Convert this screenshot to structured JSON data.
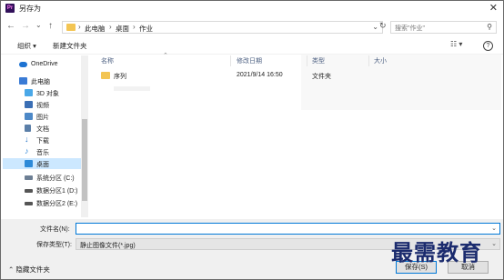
{
  "window": {
    "title": "另存为",
    "app_icon": "Pr",
    "close": "✕"
  },
  "nav": {
    "back": "←",
    "forward": "→",
    "recent": "⌄",
    "up": "↑",
    "breadcrumb": [
      "此电脑",
      "桌面",
      "作业"
    ],
    "refresh": "↻",
    "search_placeholder": "搜索\"作业\""
  },
  "toolbar": {
    "organize": "组织 ▾",
    "new_folder": "新建文件夹",
    "view": "☷ ▾",
    "help": "?"
  },
  "sidebar": {
    "items": [
      {
        "label": "OneDrive",
        "icon": "cloud-icon",
        "color": "#1e73d2"
      },
      {
        "label": "此电脑",
        "icon": "computer-icon",
        "color": "#3a7bd5"
      },
      {
        "label": "3D 对象",
        "icon": "cube-icon",
        "color": "#4aa8e8"
      },
      {
        "label": "视频",
        "icon": "video-icon",
        "color": "#3b6fb5"
      },
      {
        "label": "图片",
        "icon": "picture-icon",
        "color": "#4d88c7"
      },
      {
        "label": "文档",
        "icon": "document-icon",
        "color": "#5b7fa8"
      },
      {
        "label": "下载",
        "icon": "download-icon",
        "color": "#1f6fc4"
      },
      {
        "label": "音乐",
        "icon": "music-icon",
        "color": "#2f86d6"
      },
      {
        "label": "桌面",
        "icon": "desktop-icon",
        "color": "#2d8ad8"
      },
      {
        "label": "系统分区 (C:)",
        "icon": "drive-icon",
        "color": "#6d7f94"
      },
      {
        "label": "数据分区1 (D:)",
        "icon": "drive-icon",
        "color": "#555"
      },
      {
        "label": "数据分区2 (E:)",
        "icon": "drive-icon",
        "color": "#555"
      }
    ]
  },
  "columns": {
    "name": "名称",
    "modified": "修改日期",
    "type": "类型",
    "size": "大小"
  },
  "files": [
    {
      "name": "序列",
      "modified": "2021/9/14 16:50",
      "type": "文件夹",
      "size": ""
    }
  ],
  "form": {
    "filename_label": "文件名(N):",
    "filename_value": "",
    "filetype_label": "保存类型(T):",
    "filetype_value": "静止图像文件(*.jpg)"
  },
  "footer": {
    "hide_folders": "⌃ 隐藏文件夹",
    "save": "保存(S)",
    "cancel": "取消"
  },
  "watermark": "最需教育"
}
